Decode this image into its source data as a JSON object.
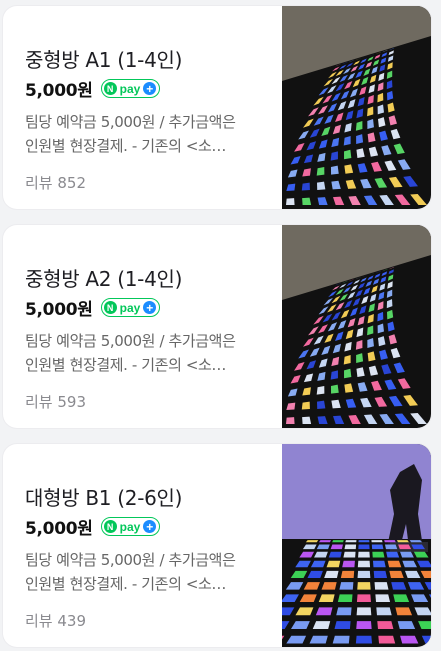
{
  "cards": [
    {
      "title": "중형방 A1 (1-4인)",
      "price": "5,000원",
      "desc_line1": "팀당 예약금 5,000원 / 추가금액은",
      "desc_line2": "인원별 현장결제. - 기존의 <소…",
      "review": "리뷰 852"
    },
    {
      "title": "중형방 A2 (1-4인)",
      "price": "5,000원",
      "desc_line1": "팀당 예약금 5,000원 / 추가금액은",
      "desc_line2": "인원별 현장결제. - 기존의 <소…",
      "review": "리뷰 593"
    },
    {
      "title": "대형방 B1 (2-6인)",
      "price": "5,000원",
      "desc_line1": "팀당 예약금 5,000원 / 추가금액은",
      "desc_line2": "인원별 현장결제. - 기존의 <소…",
      "review": "리뷰 439"
    }
  ],
  "npay": {
    "n": "N",
    "label": "pay",
    "plus": "+"
  },
  "colors": {
    "npay_green": "#03c75a",
    "plus_blue": "#1b8cff"
  },
  "icons": {
    "npay": "naver-pay-badge",
    "thumb": "led-floor-room-photo"
  }
}
